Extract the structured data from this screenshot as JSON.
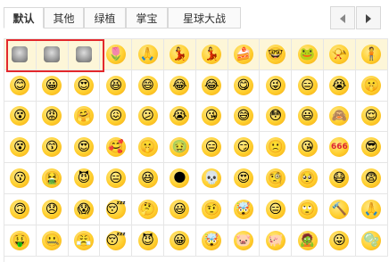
{
  "tabs": [
    {
      "label": "默认",
      "active": true
    },
    {
      "label": "其他",
      "active": false
    },
    {
      "label": "绿植",
      "active": false
    },
    {
      "label": "掌宝",
      "active": false
    },
    {
      "label": "星球大战",
      "active": false
    }
  ],
  "nav": {
    "prev_icon": "chevron-left-icon",
    "next_icon": "chevron-right-icon"
  },
  "grid": {
    "rows": [
      [
        "🐼",
        "🐱",
        "🐶",
        "🌷",
        "🙏",
        "💃",
        "💃",
        "🍰",
        "🤓",
        "🐸",
        "📯",
        "🧍"
      ],
      [
        "😊",
        "😀",
        "😍",
        "😆",
        "😄",
        "😂",
        "😂",
        "😋",
        "😜",
        "😑",
        "😭",
        "🤫"
      ],
      [
        "😵",
        "😡",
        "🤗",
        "😖",
        "😕",
        "😭",
        "😘",
        "😅",
        "😳",
        "😃",
        "🙈",
        "😌"
      ],
      [
        "😵",
        "😙",
        "😍",
        "🥰",
        "🤫",
        "🤢",
        "😑",
        "😏",
        "🙁",
        "😘",
        "666",
        "😎"
      ],
      [
        "😗",
        "🤮",
        "😈",
        "😑",
        "😆",
        "🌑",
        "💀",
        "😍",
        "🧐",
        "🥺",
        "😷",
        "😨"
      ],
      [
        "🙃",
        "😞",
        "😱",
        "😴",
        "🤔",
        "😃",
        "🤨",
        "🤯",
        "😑",
        "🙄",
        "🔨",
        "🙏"
      ],
      [
        "🤑",
        "🤐",
        "😤",
        "😴",
        "😈",
        "😀",
        "🤯",
        "🐷",
        "🐖",
        "🧟",
        "😛",
        "🫧"
      ]
    ]
  },
  "colors": {
    "highlight_border": "#e3282c",
    "cell_border": "#e6e6e6",
    "highlight_bg": "#fdf6d8"
  }
}
